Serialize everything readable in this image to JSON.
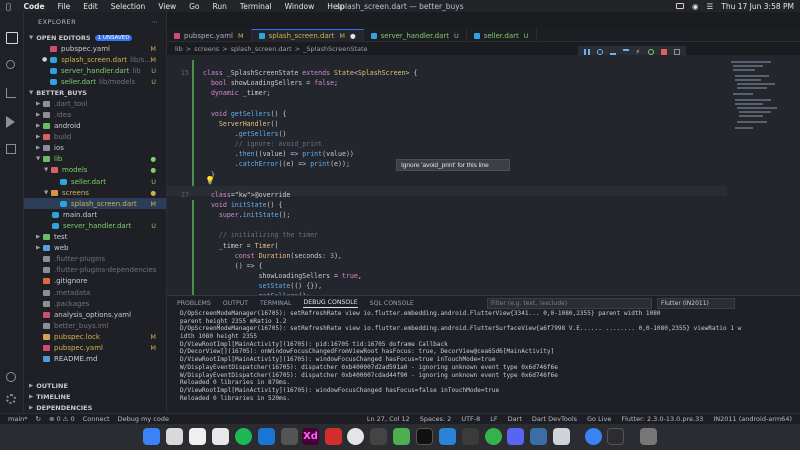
{
  "menubar": {
    "app": "Code",
    "items": [
      "File",
      "Edit",
      "Selection",
      "View",
      "Go",
      "Run",
      "Terminal",
      "Window",
      "Help"
    ],
    "window_title": "splash_screen.dart — better_buys",
    "clock": "Thu 17 Jun  3:58 PM"
  },
  "sidebar": {
    "title": "EXPLORER",
    "open_editors": {
      "label": "OPEN EDITORS",
      "badge": "1 UNSAVED"
    },
    "open_files": [
      {
        "name": "pubspec.yaml",
        "status": "M"
      },
      {
        "name": "splash_screen.dart",
        "extra": "lib/s...",
        "status": "M"
      },
      {
        "name": "server_handler.dart",
        "extra": "lib",
        "status": "U"
      },
      {
        "name": "seller.dart",
        "extra": "lib/models",
        "status": "U"
      }
    ],
    "project": "BETTER_BUYS",
    "tree": [
      {
        "name": ".dart_tool",
        "status": ""
      },
      {
        "name": ".idea",
        "status": ""
      },
      {
        "name": "android",
        "status": ""
      },
      {
        "name": "build",
        "status": ""
      },
      {
        "name": "ios",
        "status": ""
      },
      {
        "name": "lib",
        "status": ""
      },
      {
        "name": "models",
        "status": ""
      },
      {
        "name": "seller.dart",
        "status": "U"
      },
      {
        "name": "screens",
        "status": ""
      },
      {
        "name": "splash_screen.dart",
        "status": "M"
      },
      {
        "name": "main.dart",
        "status": ""
      },
      {
        "name": "server_handler.dart",
        "status": "U"
      },
      {
        "name": "test",
        "status": ""
      },
      {
        "name": "web",
        "status": ""
      },
      {
        "name": ".flutter-plugins",
        "status": ""
      },
      {
        "name": ".flutter-plugins-dependencies",
        "status": ""
      },
      {
        "name": ".gitignore",
        "status": ""
      },
      {
        "name": ".metadata",
        "status": ""
      },
      {
        "name": ".packages",
        "status": ""
      },
      {
        "name": "analysis_options.yaml",
        "status": ""
      },
      {
        "name": "better_buys.iml",
        "status": ""
      },
      {
        "name": "pubspec.lock",
        "status": "M"
      },
      {
        "name": "pubspec.yaml",
        "status": "M"
      },
      {
        "name": "README.md",
        "status": ""
      }
    ],
    "bottom_sections": [
      "OUTLINE",
      "TIMELINE",
      "DEPENDENCIES"
    ]
  },
  "tabs": [
    {
      "name": "pubspec.yaml",
      "mark": "M"
    },
    {
      "name": "splash_screen.dart",
      "mark": "M"
    },
    {
      "name": "server_handler.dart",
      "mark": "U"
    },
    {
      "name": "seller.dart",
      "mark": "U"
    }
  ],
  "breadcrumb": [
    "lib",
    ">",
    "screens",
    ">",
    "splash_screen.dart",
    ">",
    "_SplashScreenState"
  ],
  "code": {
    "lines": [
      {
        "n": "15",
        "t": "class _SplashScreenState extends State<SplashScreen> {"
      },
      {
        "n": "",
        "t": "  bool showLoadingSellers = false;"
      },
      {
        "n": "",
        "t": "  dynamic _timer;"
      },
      {
        "n": "",
        "t": ""
      },
      {
        "n": "",
        "t": "  void getSellers() {"
      },
      {
        "n": "",
        "t": "    ServerHandler()"
      },
      {
        "n": "",
        "t": "        .getSellers()"
      },
      {
        "n": "",
        "t": "        // ignore: avoid_print"
      },
      {
        "n": "",
        "t": "        .then((value) => print(value))"
      },
      {
        "n": "",
        "t": "        .catchError((e) => print(e));"
      },
      {
        "n": "",
        "t": "  }"
      },
      {
        "n": "",
        "t": ""
      },
      {
        "n": "27",
        "t": "  @override"
      },
      {
        "n": "",
        "t": "  void initState() {"
      },
      {
        "n": "",
        "t": "    super.initState();"
      },
      {
        "n": "",
        "t": ""
      },
      {
        "n": "",
        "t": "    // initializing the timer"
      },
      {
        "n": "",
        "t": "    _timer = Timer("
      },
      {
        "n": "",
        "t": "        const Duration(seconds: 3),"
      },
      {
        "n": "",
        "t": "        () => {"
      },
      {
        "n": "",
        "t": "              showLoadingSellers = true,"
      },
      {
        "n": "",
        "t": "              setState(() {}),"
      },
      {
        "n": "",
        "t": "              getSellers();"
      }
    ],
    "tooltip": "Ignore 'avoid_print' for this line"
  },
  "panel": {
    "tabs": [
      "PROBLEMS",
      "OUTPUT",
      "TERMINAL",
      "DEBUG CONSOLE",
      "SQL CONSOLE"
    ],
    "active_tab": "DEBUG CONSOLE",
    "filter_placeholder": "Filter (e.g. text, !exclude)",
    "device": "Flutter (IN2011)",
    "logs": [
      "D/OpScreenModeManager(16705): setRefreshRate view io.flutter.embedding.android.FlutterView{3341... 0,0-1080,2355} parent width 1080",
      "parent height 2355 mRatio 1.2",
      "D/OpScreenModeManager(16705): setRefreshRate view io.flutter.embedding.android.FlutterSurfaceView{a6f7998 V.E...... ........ 0,0-1080,2355} viewRatio 1 w",
      "idth 1080 height 2355",
      "D/ViewRootImpl[MainActivity](16705): pid:16705 tid:16705 doframe Callback",
      "D/DecorView[](16705): onWindowFocusChangedFromViewRoot hasFocus: true, DecorView@cea65d6[MainActivity]",
      "D/ViewRootImpl[MainActivity](16705): windowFocusChanged hasFocus=true inTouchMode=true",
      "W/DisplayEventDispatcher(16705): dispatcher 0xb400007d2ad591a0 - ignoring unknown event type 0x6d746f6e",
      "W/DisplayEventDispatcher(16705): dispatcher 0xb400007cdad44f90 - ignoring unknown event type 0x6d746f6e",
      "Reloaded 0 libraries in 879ms.",
      "D/ViewRootImpl[MainActivity](16705): windowFocusChanged hasFocus=false inTouchMode=true",
      "Reloaded 0 libraries in 520ms."
    ]
  },
  "status": {
    "branch": "main*",
    "connect": "Connect",
    "debug": "Debug my code",
    "position": "Ln 27, Col 12",
    "spaces": "Spaces: 2",
    "encoding": "UTF-8",
    "eol": "LF",
    "lang": "Dart",
    "devtools": "Dart DevTools",
    "golive": "Go Live",
    "flutter": "Flutter: 2.3.0-13.0.pre.33",
    "device": "IN2011 (android-arm64)"
  },
  "colors": {
    "accent": "#3574f0",
    "modified": "#d4b24a",
    "untracked": "#7fcf6a"
  }
}
